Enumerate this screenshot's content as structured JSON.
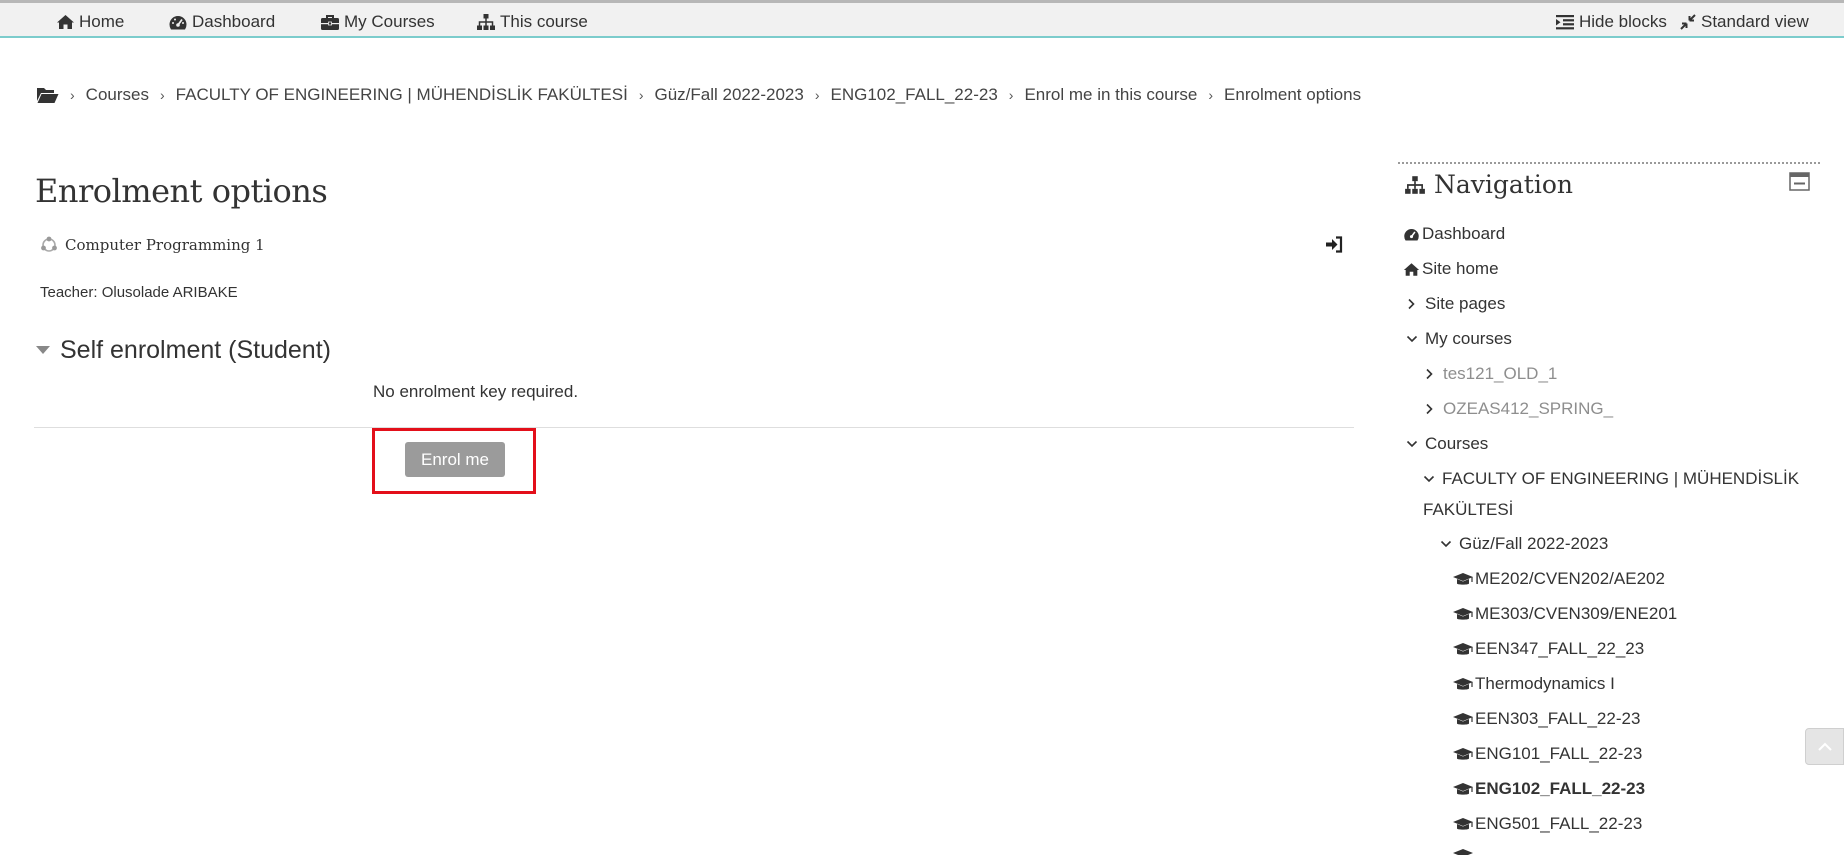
{
  "topnav": {
    "home": "Home",
    "dashboard": "Dashboard",
    "my_courses": "My Courses",
    "this_course": "This course",
    "hide_blocks": "Hide blocks",
    "standard_view": "Standard view"
  },
  "breadcrumb": [
    "Courses",
    "FACULTY OF ENGINEERING | MÜHENDİSLİK FAKÜLTESİ",
    "Güz/Fall 2022-2023",
    "ENG102_FALL_22-23",
    "Enrol me in this course",
    "Enrolment options"
  ],
  "page": {
    "title": "Enrolment options",
    "course_name": "Computer Programming 1",
    "teacher": "Teacher: Olusolade ARIBAKE"
  },
  "self_enrolment": {
    "heading": "Self enrolment (Student)",
    "note": "No enrolment key required.",
    "button": "Enrol me"
  },
  "navigation": {
    "title": "Navigation",
    "dashboard": "Dashboard",
    "site_home": "Site home",
    "site_pages": "Site pages",
    "my_courses": "My courses",
    "my_course_items": [
      "tes121_OLD_1",
      "OZEAS412_SPRING_"
    ],
    "courses": "Courses",
    "faculty_line1": "FACULTY OF ENGINEERING | MÜHENDİSLİK",
    "faculty_line2": "FAKÜLTESİ",
    "term": "Güz/Fall 2022-2023",
    "course_list": [
      "ME202/CVEN202/AE202",
      "ME303/CVEN309/ENE201",
      "EEN347_FALL_22_23",
      "Thermodynamics I",
      "EEN303_FALL_22-23",
      "ENG101_FALL_22-23",
      "ENG102_FALL_22-23",
      "ENG501_FALL_22-23"
    ],
    "active_course": "ENG102_FALL_22-23"
  },
  "colors": {
    "accent_line": "#7ccccc",
    "highlight": "#e30f1a",
    "button": "#9b9b9b"
  }
}
